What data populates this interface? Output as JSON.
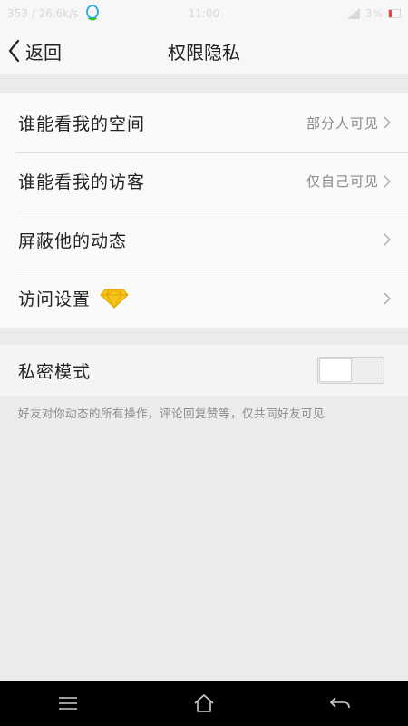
{
  "status_bar": {
    "left_text": "353 / 26.6k/s",
    "time": "11:00",
    "battery": "3%"
  },
  "header": {
    "back_label": "返回",
    "title": "权限隐私"
  },
  "settings": [
    {
      "label": "谁能看我的空间",
      "value": "部分人可见"
    },
    {
      "label": "谁能看我的访客",
      "value": "仅自己可见"
    },
    {
      "label": "屏蔽他的动态",
      "value": ""
    },
    {
      "label": "访问设置",
      "value": "",
      "icon": "diamond-icon"
    }
  ],
  "private_mode": {
    "label": "私密模式",
    "enabled": false,
    "description": "好友对你动态的所有操作，评论回复赞等，仅共同好友可见"
  },
  "colors": {
    "background": "#ebebeb",
    "diamond": "#f2b705"
  }
}
